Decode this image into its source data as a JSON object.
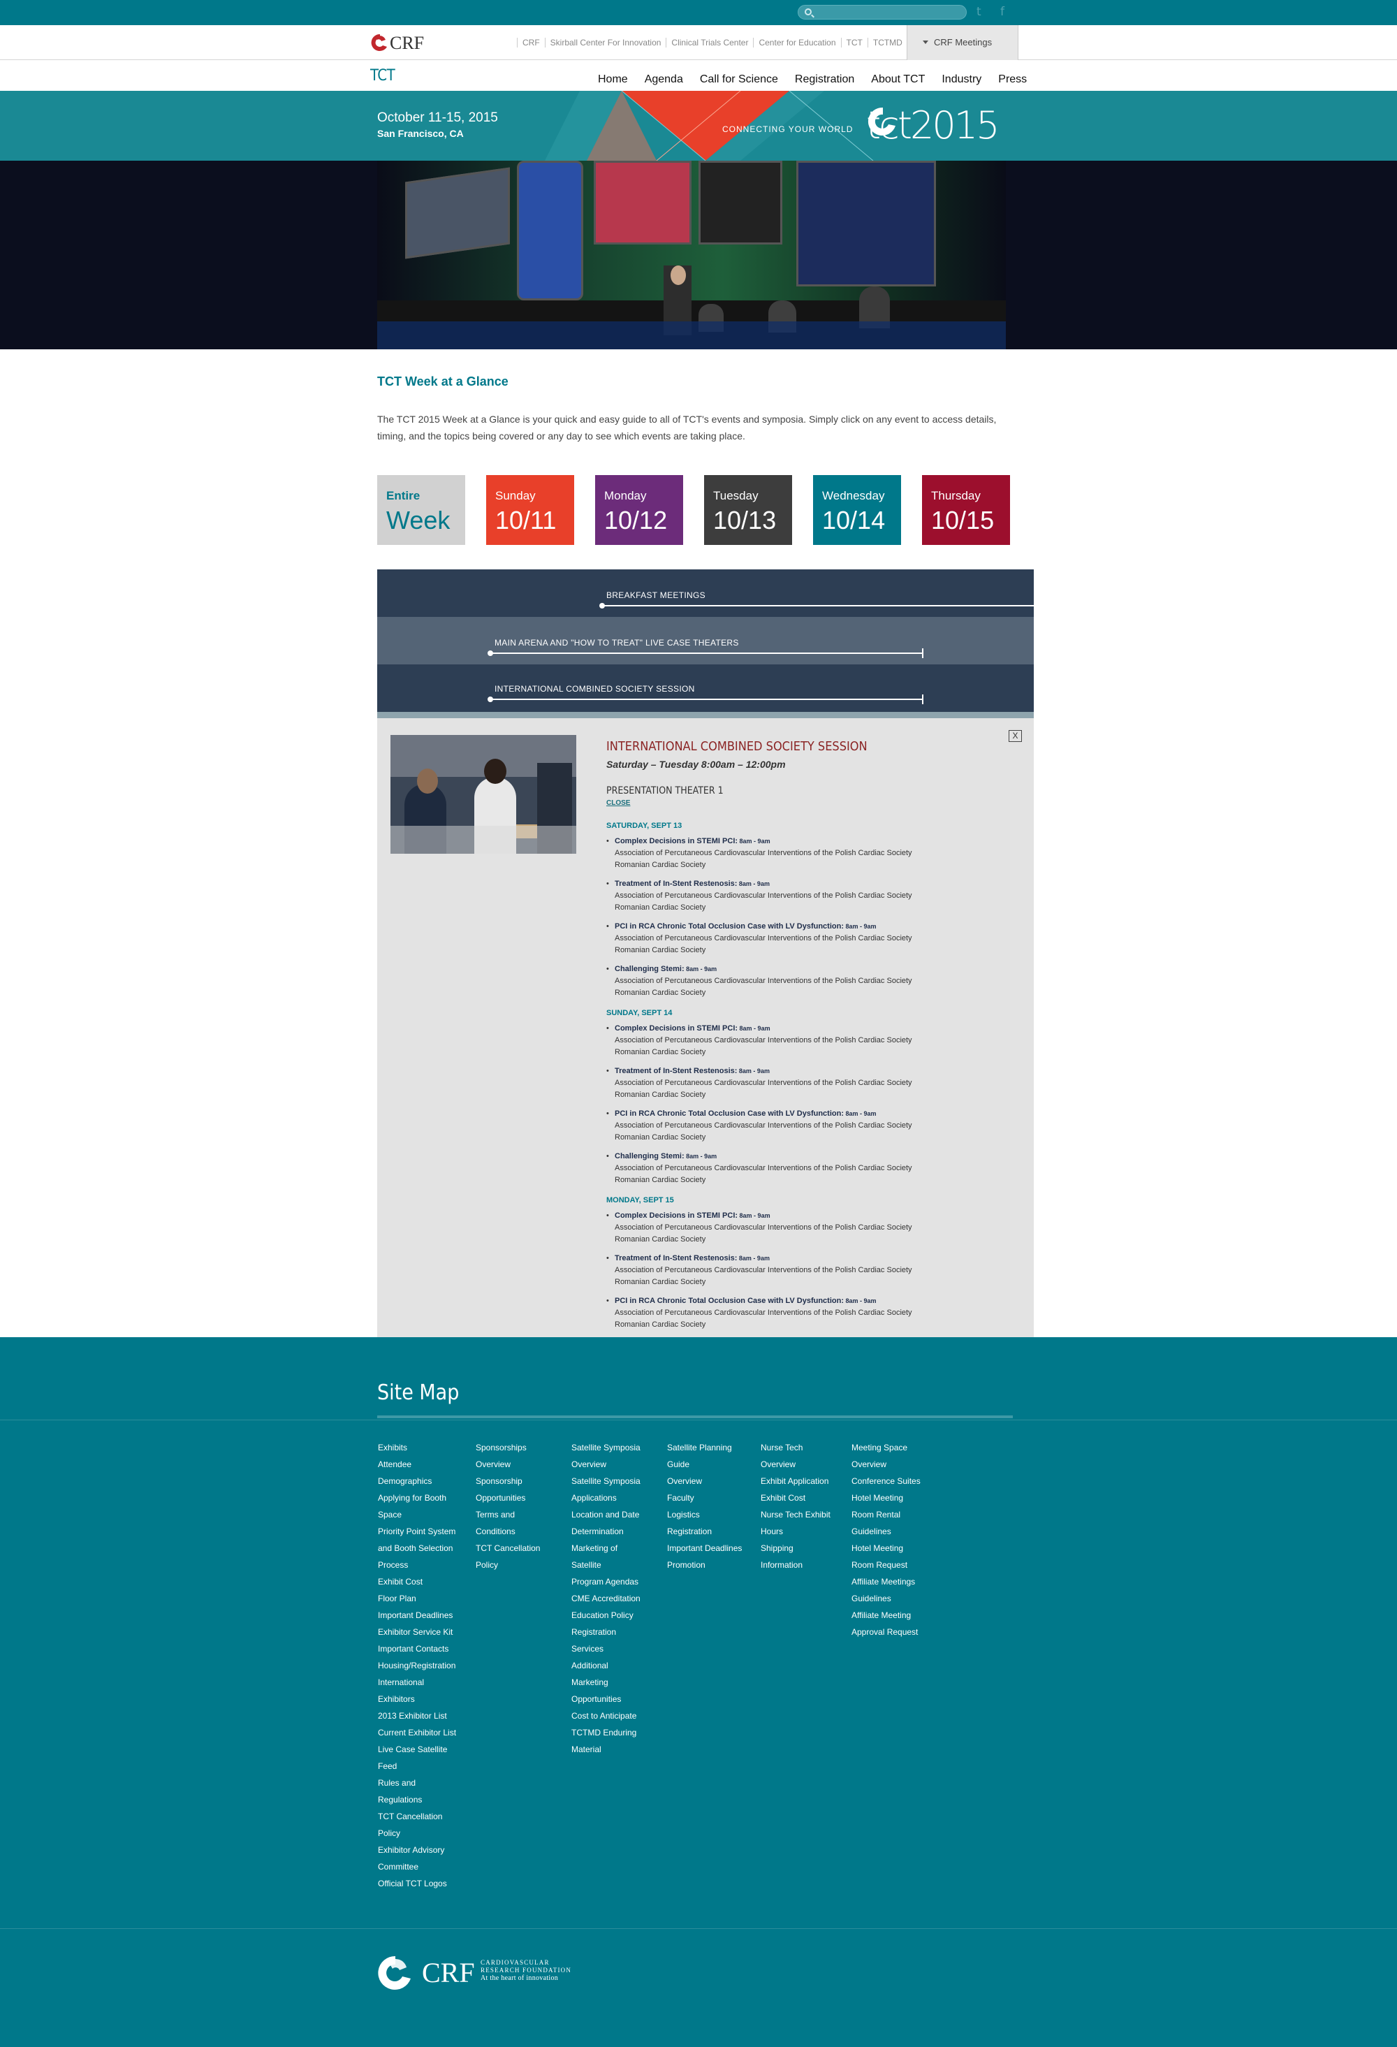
{
  "topbar": {
    "search_placeholder": "",
    "twitter_icon": "t",
    "facebook_icon": "f"
  },
  "crf_bar": {
    "logo": "CRF",
    "links": [
      "CRF",
      "Skirball Center For Innovation",
      "Clinical Trials Center",
      "Center for Education",
      "TCT",
      "TCTMD"
    ],
    "meetings_label": "CRF Meetings"
  },
  "nav": {
    "brand": "TCT",
    "items": [
      "Home",
      "Agenda",
      "Call for Science",
      "Registration",
      "About TCT",
      "Industry",
      "Press"
    ]
  },
  "band": {
    "date": "October 11-15, 2015",
    "location": "San Francisco, CA",
    "tagline": "CONNECTING YOUR WORLD",
    "logo": "tct2015"
  },
  "colors": {
    "teal": "#00788a",
    "sunday": "#e8402a",
    "monday": "#6c2c7a",
    "tuesday": "#3d3d3d",
    "wednesday": "#00788a",
    "thursday": "#9c0f2d",
    "entire": "#d1d1d1",
    "timeline_dark": "#2d3e54",
    "timeline_light": "#546476",
    "session_title": "#8b2424"
  },
  "page": {
    "title": "TCT Week at a Glance",
    "intro": "The TCT 2015 Week at a Glance is your quick and easy guide to all of TCT's events and symposia. Simply click on any event to access details, timing, and the topics being covered or any day to see which events are taking place."
  },
  "days": [
    {
      "name": "Entire",
      "num": "Week"
    },
    {
      "name": "Sunday",
      "num": "10/11"
    },
    {
      "name": "Monday",
      "num": "10/12"
    },
    {
      "name": "Tuesday",
      "num": "10/13"
    },
    {
      "name": "Wednesday",
      "num": "10/14"
    },
    {
      "name": "Thursday",
      "num": "10/15"
    }
  ],
  "timeline": [
    {
      "label": "BREAKFAST MEETINGS"
    },
    {
      "label": "MAIN ARENA AND \"HOW TO TREAT\" LIVE CASE THEATERS"
    },
    {
      "label": "INTERNATIONAL COMBINED SOCIETY SESSION"
    }
  ],
  "session": {
    "title": "INTERNATIONAL COMBINED SOCIETY SESSION",
    "time": "Saturday – Tuesday 8:00am – 12:00pm",
    "room": "PRESENTATION THEATER 1",
    "close_label": "CLOSE",
    "close_x": "X",
    "groups": [
      {
        "day": "SATURDAY, SEPT 13",
        "items": [
          {
            "title": "Complex Decisions in STEMI PCI:",
            "time": " 8am - 9am",
            "org": "Association of Percutaneous Cardiovascular Interventions of the Polish Cardiac Society",
            "org2": "Romanian Cardiac Society"
          },
          {
            "title": "Treatment of In-Stent Restenosis:",
            "time": " 8am - 9am",
            "org": "Association of Percutaneous Cardiovascular Interventions of the Polish Cardiac Society",
            "org2": "Romanian Cardiac Society"
          },
          {
            "title": "PCI in RCA Chronic Total Occlusion Case with LV Dysfunction:",
            "time": " 8am - 9am",
            "org": "Association of Percutaneous Cardiovascular Interventions of the Polish Cardiac Society",
            "org2": "Romanian Cardiac Society"
          },
          {
            "title": "Challenging Stemi:",
            "time": " 8am - 9am",
            "org": "Association of Percutaneous Cardiovascular Interventions of the Polish Cardiac Society",
            "org2": "Romanian Cardiac Society"
          }
        ]
      },
      {
        "day": "SUNDAY, SEPT 14",
        "items": [
          {
            "title": "Complex Decisions in STEMI PCI:",
            "time": " 8am - 9am",
            "org": "Association of Percutaneous Cardiovascular Interventions of the Polish Cardiac Society",
            "org2": "Romanian Cardiac Society"
          },
          {
            "title": "Treatment of In-Stent Restenosis:",
            "time": " 8am - 9am",
            "org": "Association of Percutaneous Cardiovascular Interventions of the Polish Cardiac Society",
            "org2": "Romanian Cardiac Society"
          },
          {
            "title": "PCI in RCA Chronic Total Occlusion Case with LV Dysfunction:",
            "time": " 8am - 9am",
            "org": "Association of Percutaneous Cardiovascular Interventions of the Polish Cardiac Society",
            "org2": "Romanian Cardiac Society"
          },
          {
            "title": "Challenging Stemi:",
            "time": " 8am - 9am",
            "org": "Association of Percutaneous Cardiovascular Interventions of the Polish Cardiac Society",
            "org2": "Romanian Cardiac Society"
          }
        ]
      },
      {
        "day": "MONDAY, SEPT 15",
        "items": [
          {
            "title": "Complex Decisions in STEMI PCI:",
            "time": " 8am - 9am",
            "org": "Association of Percutaneous Cardiovascular Interventions of the Polish Cardiac Society",
            "org2": "Romanian Cardiac Society"
          },
          {
            "title": "Treatment of In-Stent Restenosis:",
            "time": " 8am - 9am",
            "org": "Association of Percutaneous Cardiovascular Interventions of the Polish Cardiac Society",
            "org2": "Romanian Cardiac Society"
          },
          {
            "title": "PCI in RCA Chronic Total Occlusion Case with LV Dysfunction:",
            "time": " 8am - 9am",
            "org": "Association of Percutaneous Cardiovascular Interventions of the Polish Cardiac Society",
            "org2": "Romanian Cardiac Society"
          }
        ]
      }
    ]
  },
  "footer": {
    "sitemap_title": "Site Map",
    "columns": [
      [
        "Exhibits",
        "Attendee",
        "Demographics",
        "Applying for Booth",
        "Space",
        "Priority Point System",
        "and Booth Selection",
        "Process",
        "Exhibit Cost",
        "Floor Plan",
        "Important Deadlines",
        "Exhibitor Service Kit",
        "Important Contacts",
        "Housing/Registration",
        "International",
        "Exhibitors",
        "2013 Exhibitor List",
        "Current Exhibitor List",
        "Live Case Satellite",
        "Feed",
        "Rules and",
        "Regulations",
        "TCT Cancellation",
        "Policy",
        "Exhibitor Advisory",
        "Committee",
        "Official TCT Logos"
      ],
      [
        "Sponsorships",
        "Overview",
        "Sponsorship",
        "Opportunities",
        "Terms and",
        "Conditions",
        "TCT Cancellation",
        "Policy"
      ],
      [
        "Satellite Symposia",
        "Overview",
        "Satellite Symposia",
        "Applications",
        "Location and Date",
        "Determination",
        "Marketing of",
        "Satellite",
        "Program Agendas",
        "CME Accreditation",
        "Education Policy",
        "Registration",
        "Services",
        "Additional",
        "Marketing",
        "Opportunities",
        "Cost to Anticipate",
        "TCTMD Enduring",
        "Material"
      ],
      [
        "Satellite Planning",
        "Guide",
        "Overview",
        "Faculty",
        "Logistics",
        "Registration",
        "Important Deadlines",
        "Promotion"
      ],
      [
        "Nurse Tech",
        "Overview",
        "Exhibit Application",
        "Exhibit Cost",
        "Nurse Tech Exhibit",
        "Hours",
        "Shipping",
        "Information"
      ],
      [
        "Meeting Space",
        "Overview",
        "Conference Suites",
        "Hotel Meeting",
        "Room Rental",
        "Guidelines",
        "Hotel Meeting",
        "Room Request",
        "Affiliate Meetings",
        "Guidelines",
        "Affiliate Meeting",
        "Approval Request"
      ]
    ],
    "logo_text": "CRF",
    "logo_sub1": "CARDIOVASCULAR",
    "logo_sub2": "RESEARCH FOUNDATION",
    "logo_tagline": "At the heart of innovation"
  }
}
